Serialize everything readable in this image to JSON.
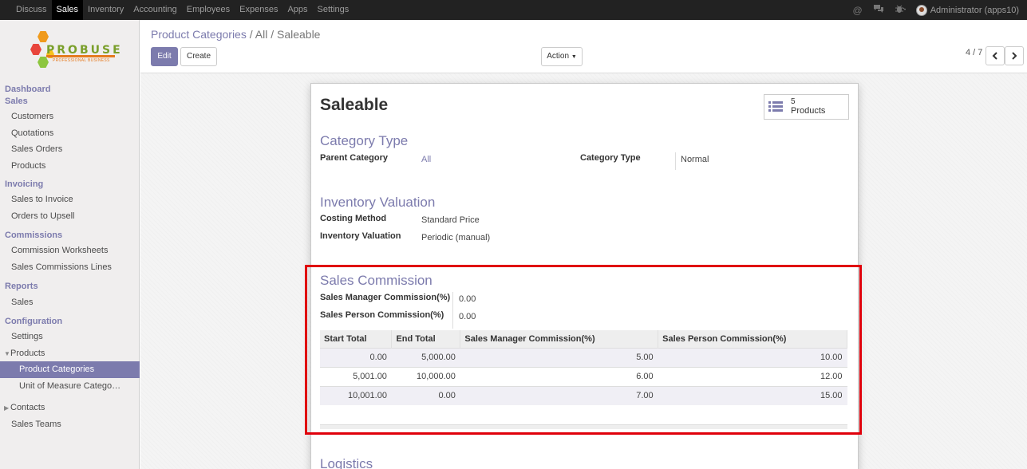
{
  "topbar": {
    "menu": [
      "Discuss",
      "Sales",
      "Inventory",
      "Accounting",
      "Employees",
      "Expenses",
      "Apps",
      "Settings"
    ],
    "active_menu": "Sales",
    "user": "Administrator (apps10)",
    "icons": [
      "at-icon",
      "chat-icon",
      "bug-icon"
    ]
  },
  "logo": {
    "brand": "PROBUSE",
    "tagline": "PROFESSIONAL BUSINESS"
  },
  "sidebar": {
    "dashboard": "Dashboard",
    "sales_header": "Sales",
    "sales_items": [
      "Customers",
      "Quotations",
      "Sales Orders",
      "Products"
    ],
    "invoicing_header": "Invoicing",
    "invoicing_items": [
      "Sales to Invoice",
      "Orders to Upsell"
    ],
    "commissions_header": "Commissions",
    "commissions_items": [
      "Commission Worksheets",
      "Sales Commissions Lines"
    ],
    "reports_header": "Reports",
    "reports_items": [
      "Sales"
    ],
    "configuration_header": "Configuration",
    "configuration_items": [
      "Settings"
    ],
    "products_group": "Products",
    "products_sub": [
      "Product Categories",
      "Unit of Measure Catego…"
    ],
    "contacts": "Contacts",
    "sales_teams": "Sales Teams"
  },
  "breadcrumb": {
    "link": "Product Categories",
    "sep": "/",
    "current": "All / Saleable"
  },
  "buttons": {
    "edit": "Edit",
    "create": "Create",
    "action": "Action"
  },
  "pager": {
    "value": "4 / 7"
  },
  "record": {
    "title": "Saleable",
    "products_count": "5",
    "products_label": "Products",
    "category_type_header": "Category Type",
    "parent_category_label": "Parent Category",
    "parent_category_value": "All",
    "category_type_label": "Category Type",
    "category_type_value": "Normal",
    "inventory_header": "Inventory Valuation",
    "costing_method_label": "Costing Method",
    "costing_method_value": "Standard Price",
    "inventory_valuation_label": "Inventory Valuation",
    "inventory_valuation_value": "Periodic (manual)",
    "commission_header": "Sales Commission",
    "manager_commission_label": "Sales Manager Commission(%)",
    "manager_commission_value": "0.00",
    "person_commission_label": "Sales Person Commission(%)",
    "person_commission_value": "0.00",
    "table_headers": [
      "Start Total",
      "End Total",
      "Sales Manager Commission(%)",
      "Sales Person Commission(%)"
    ],
    "table_rows": [
      [
        "0.00",
        "5,000.00",
        "5.00",
        "10.00"
      ],
      [
        "5,001.00",
        "10,000.00",
        "6.00",
        "12.00"
      ],
      [
        "10,001.00",
        "0.00",
        "7.00",
        "15.00"
      ]
    ],
    "logistics_header": "Logistics"
  },
  "colors": {
    "accent": "#7c7bad",
    "highlight_box": "#e0000b",
    "topbar": "#222222"
  }
}
